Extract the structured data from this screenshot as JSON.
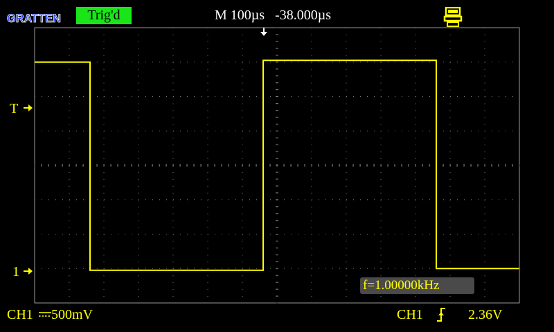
{
  "header": {
    "logo_text": "GRATTEN",
    "trigger_status": "Trig'd",
    "timebase": "M 100µs   -38.000µs",
    "icon": "printer-icon"
  },
  "markers": {
    "trigger_level_label": "T",
    "channel_ground_label": "1"
  },
  "measurement": {
    "frequency": "f=1.00000kHz"
  },
  "footer": {
    "channel": "CH1",
    "volts_per_div": "500mV",
    "coupling_icon": "dc-coupling-icon",
    "trigger_source": "CH1",
    "trigger_edge_icon": "rising-edge-icon",
    "trigger_level": "2.36V"
  },
  "colors": {
    "trace": "#ffff00",
    "trig_badge": "#19e619",
    "grid": "#7a7a7a"
  },
  "chart_data": {
    "type": "line",
    "signal": "square",
    "x_divisions": 14,
    "y_divisions": 8,
    "grid": true,
    "series": [
      {
        "x_div": [
          0,
          1.6,
          1.6,
          6.6,
          6.6,
          11.6,
          11.6,
          14
        ],
        "y_div": [
          7.0,
          7.0,
          0.95,
          0.95,
          7.05,
          7.05,
          1.0,
          1.0
        ]
      }
    ]
  }
}
